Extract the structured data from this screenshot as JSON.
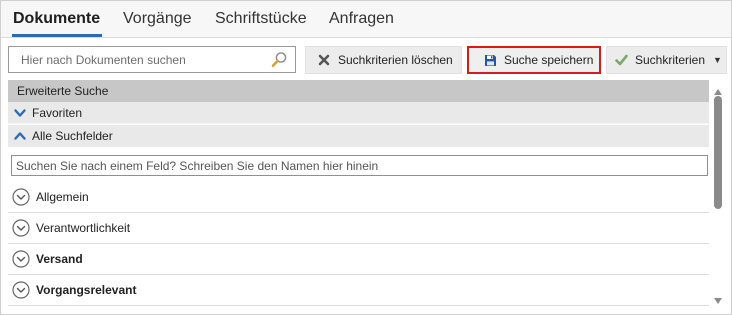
{
  "tabs": [
    {
      "label": "Dokumente",
      "active": true
    },
    {
      "label": "Vorgänge",
      "active": false
    },
    {
      "label": "Schriftstücke",
      "active": false
    },
    {
      "label": "Anfragen",
      "active": false
    }
  ],
  "toolbar": {
    "search_placeholder": "Hier nach Dokumenten suchen",
    "search_icon": "magnifier-icon",
    "clear_label": "Suchkriterien löschen",
    "clear_icon": "x-icon",
    "save_label": "Suche speichern",
    "save_icon": "floppy-disk-icon",
    "criteria_label": "Suchkriterien",
    "criteria_icon": "checkmark-icon"
  },
  "panel": {
    "header": "Erweiterte Suche",
    "favorites_label": "Favoriten",
    "all_fields_label": "Alle Suchfelder",
    "field_search_placeholder": "Suchen Sie nach einem Feld? Schreiben Sie den Namen hier hinein",
    "sections": [
      {
        "label": "Allgemein",
        "bold": false
      },
      {
        "label": "Verantwortlichkeit",
        "bold": false
      },
      {
        "label": "Versand",
        "bold": true
      },
      {
        "label": "Vorgangsrelevant",
        "bold": true
      }
    ]
  },
  "colors": {
    "accent": "#2b6cb0",
    "highlight_border": "#d91a1a",
    "check": "#6aa84f",
    "header_band": "#c7c7c7"
  }
}
